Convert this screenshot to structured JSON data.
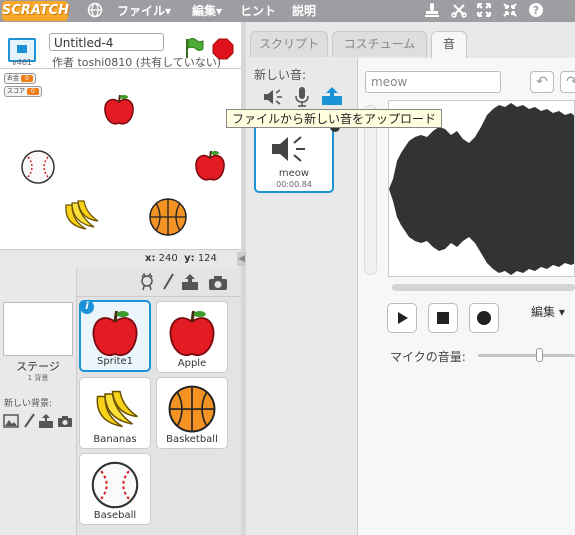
{
  "app": {
    "logo": "SCRATCH",
    "menu": [
      "ファイル▾",
      "編集▾",
      "ヒント",
      "説明"
    ]
  },
  "project": {
    "title": "Untitled-4",
    "author": "作者 toshi0810 (共有していない)",
    "version": "v461"
  },
  "stage": {
    "monitors": [
      {
        "label": "お金",
        "value": "0"
      },
      {
        "label": "スコア",
        "value": "0"
      }
    ],
    "x_label": "x:",
    "x_value": "240",
    "y_label": "y:",
    "y_value": "124"
  },
  "stage_panel": {
    "label": "ステージ",
    "backdrop_count": "1 背景",
    "new_backdrop": "新しい背景:"
  },
  "sprites": [
    {
      "name": "Sprite1",
      "icon": "apple-icon",
      "selected": true
    },
    {
      "name": "Apple",
      "icon": "apple-icon",
      "selected": false
    },
    {
      "name": "Bananas",
      "icon": "bananas-icon",
      "selected": false
    },
    {
      "name": "Basketball",
      "icon": "basketball-icon",
      "selected": false
    },
    {
      "name": "Baseball",
      "icon": "baseball-icon",
      "selected": false
    }
  ],
  "tabs": [
    "スクリプト",
    "コスチューム",
    "音"
  ],
  "sounds": {
    "new_label": "新しい音:",
    "items": [
      {
        "name": "meow",
        "duration": "00:00.84"
      }
    ]
  },
  "editor": {
    "sound_name": "meow",
    "edit_menu": "編集 ▾",
    "mic_volume_label": "マイクの音量:",
    "mic_volume": 0.6
  },
  "tooltip": "ファイルから新しい音をアップロード",
  "colors": {
    "accent": "#1b93d6",
    "topbar": "#9c9ea2",
    "logo": "#f6a72c"
  }
}
